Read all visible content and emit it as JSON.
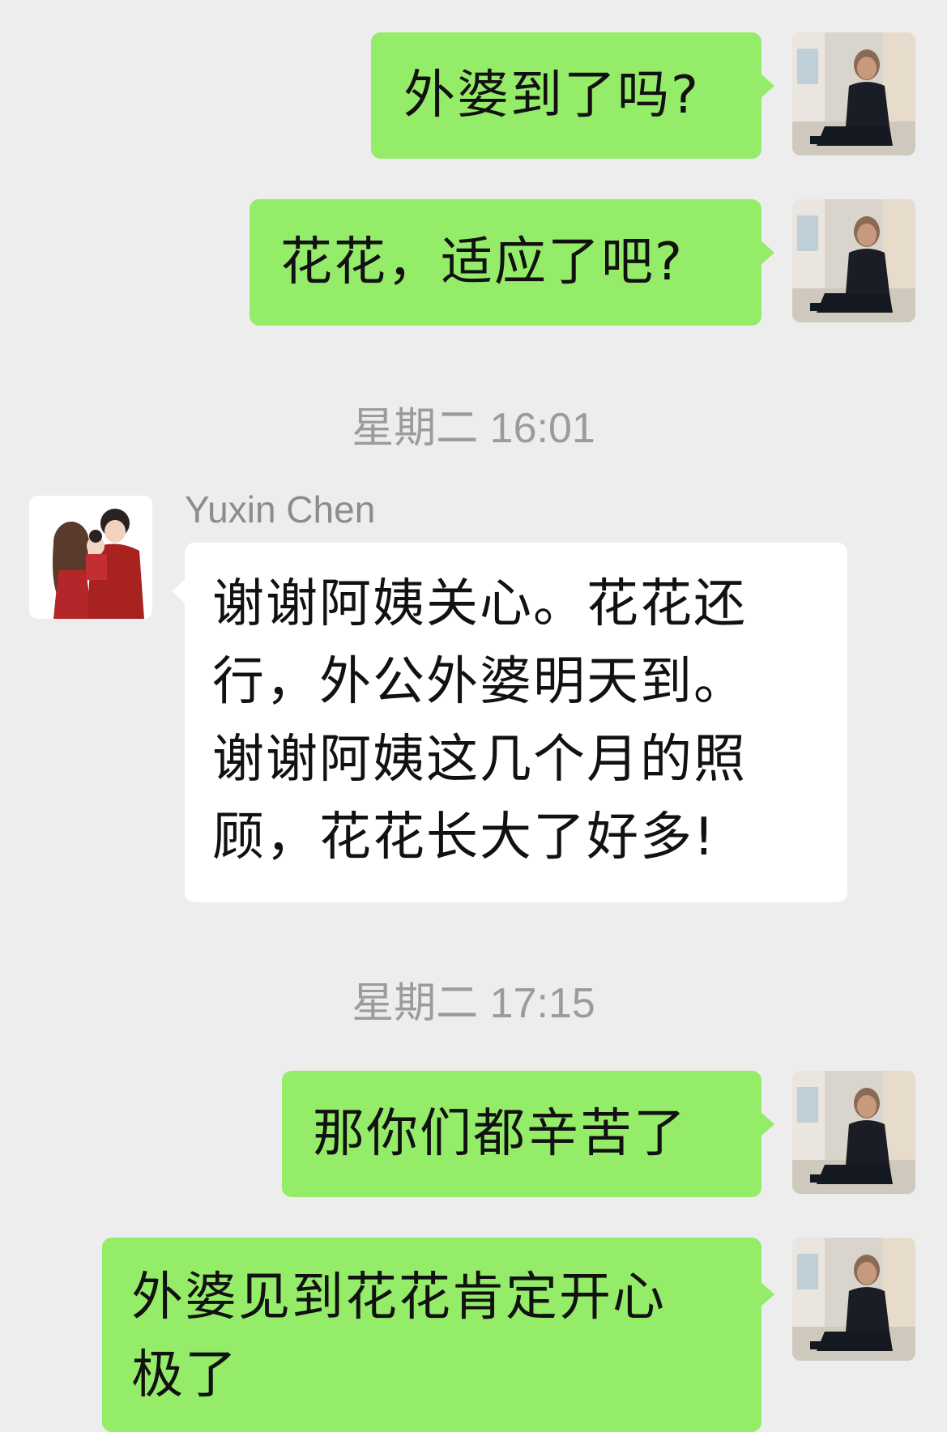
{
  "messages": [
    {
      "id": "m1",
      "direction": "out",
      "text": "外婆到了吗?"
    },
    {
      "id": "m2",
      "direction": "out",
      "text": "花花，适应了吧?"
    },
    {
      "id": "t1",
      "type": "timestamp",
      "text": "星期二 16:01"
    },
    {
      "id": "m3",
      "direction": "in",
      "sender": "Yuxin Chen",
      "lines": [
        "谢谢阿姨关心。花花还",
        "行，外公外婆明天到。",
        "谢谢阿姨这几个月的照",
        "顾，花花长大了好多!"
      ]
    },
    {
      "id": "t2",
      "type": "timestamp",
      "text": "星期二 17:15"
    },
    {
      "id": "m4",
      "direction": "out",
      "text": "那你们都辛苦了"
    },
    {
      "id": "m5",
      "direction": "out",
      "lines": [
        "外婆见到花花肯定开心",
        "极了"
      ]
    }
  ],
  "colors": {
    "background": "#ededed",
    "outgoing_bubble": "#95ec69",
    "incoming_bubble": "#ffffff",
    "timestamp_text": "#9b9b9b"
  },
  "avatars": {
    "self": "woman-seated-photo-avatar",
    "contact": "couple-with-child-illustration-avatar"
  }
}
